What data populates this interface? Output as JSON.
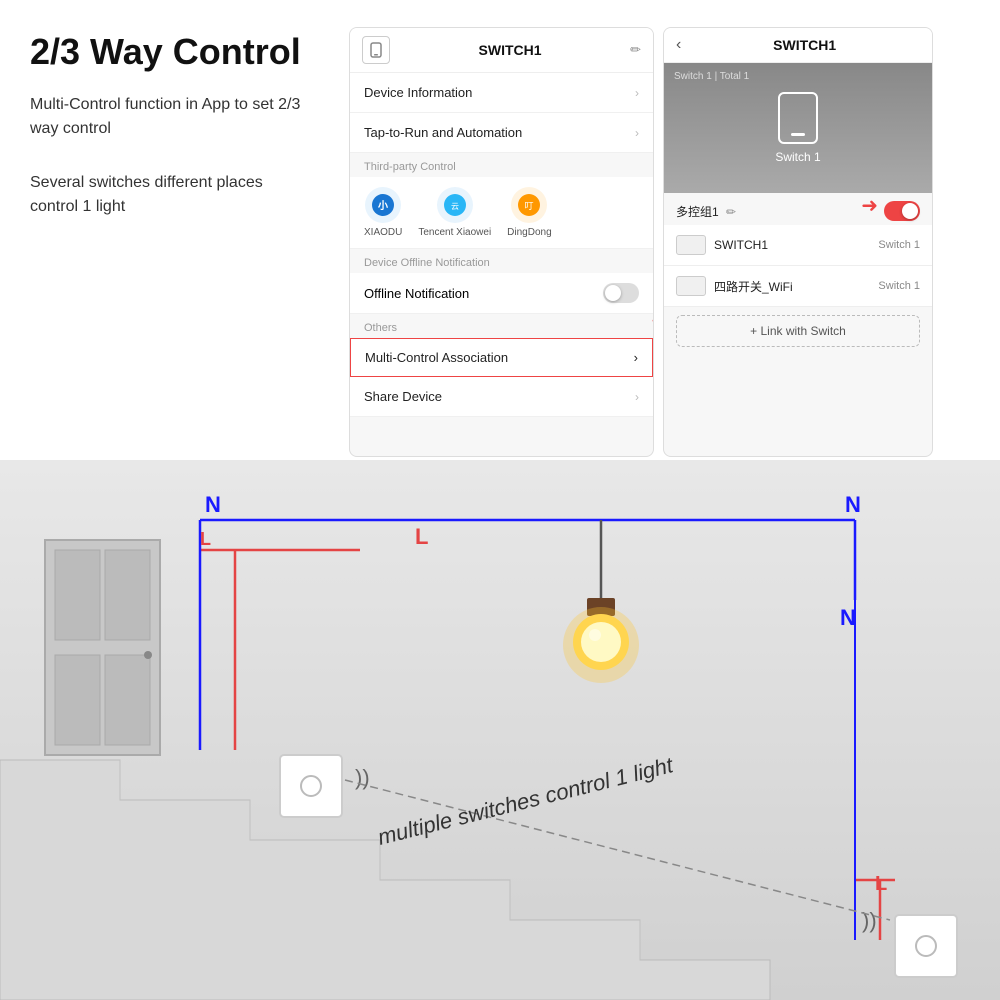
{
  "title": "2/3 Way Control",
  "desc1": "Multi-Control function in App to set 2/3 way control",
  "desc2": "Several switches different places control 1 light",
  "left_phone": {
    "header_title": "SWITCH1",
    "menu_items": [
      {
        "label": "Device Information",
        "has_chevron": true
      },
      {
        "label": "Tap-to-Run and Automation",
        "has_chevron": true
      }
    ],
    "section_third_party": "Third-party Control",
    "third_party": [
      {
        "name": "XIAODU",
        "emoji": "🔵"
      },
      {
        "name": "Tencent Xiaowei",
        "emoji": "☁️"
      },
      {
        "name": "DingDong",
        "emoji": "🔶"
      }
    ],
    "section_offline": "Device Offline Notification",
    "offline_label": "Offline Notification",
    "section_others": "Others",
    "multi_control": "Multi-Control Association",
    "share_device": "Share Device"
  },
  "right_phone": {
    "header_title": "SWITCH1",
    "banner_label": "Switch 1 | Total 1",
    "device_name": "Switch 1",
    "multicontrol_group": "多控组1",
    "devices": [
      {
        "name": "SWITCH1",
        "sub": "Switch 1"
      },
      {
        "name": "四路开关_WiFi",
        "sub": "Switch 1"
      }
    ],
    "link_button": "+ Link with Switch"
  },
  "diagram": {
    "label_n1": "N",
    "label_l1": "L",
    "label_l2": "L",
    "label_n2": "N",
    "label_n3": "N",
    "label_l3": "L",
    "diagonal_text": "multiple switches control 1 light",
    "wifi_icon": "wifi"
  },
  "colors": {
    "blue": "#1a1aff",
    "red": "#e44",
    "accent_red": "#e44444"
  }
}
